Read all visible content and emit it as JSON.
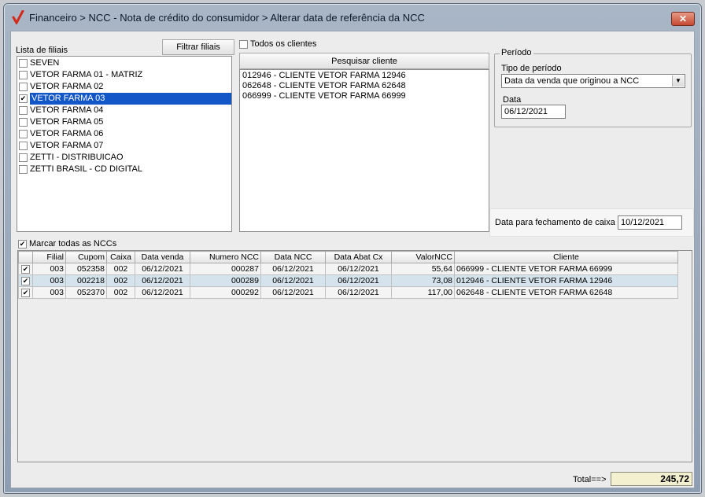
{
  "window": {
    "title": "Financeiro > NCC - Nota de crédito do consumidor > Alterar data de referência da NCC",
    "close_label": "✕"
  },
  "branches": {
    "label": "Lista de filiais",
    "filter_button": "Filtrar filiais",
    "items": [
      {
        "label": "SEVEN",
        "checked": false,
        "selected": false
      },
      {
        "label": "VETOR FARMA 01 - MATRIZ",
        "checked": false,
        "selected": false
      },
      {
        "label": "VETOR FARMA 02",
        "checked": false,
        "selected": false
      },
      {
        "label": "VETOR FARMA 03",
        "checked": true,
        "selected": true
      },
      {
        "label": "VETOR FARMA 04",
        "checked": false,
        "selected": false
      },
      {
        "label": "VETOR FARMA 05",
        "checked": false,
        "selected": false
      },
      {
        "label": "VETOR FARMA 06",
        "checked": false,
        "selected": false
      },
      {
        "label": "VETOR FARMA 07",
        "checked": false,
        "selected": false
      },
      {
        "label": "ZETTI - DISTRIBUICAO",
        "checked": false,
        "selected": false
      },
      {
        "label": "ZETTI BRASIL - CD DIGITAL",
        "checked": false,
        "selected": false
      }
    ]
  },
  "clients": {
    "all_label": "Todos os clientes",
    "all_checked": false,
    "search_button": "Pesquisar cliente",
    "items": [
      "012946 - CLIENTE VETOR FARMA 12946",
      "062648 - CLIENTE VETOR FARMA 62648",
      "066999 - CLIENTE VETOR FARMA 66999"
    ]
  },
  "period": {
    "group_title": "Período",
    "type_label": "Tipo de período",
    "type_value": "Data da venda que originou a NCC",
    "date_label": "Data",
    "date_value": "06/12/2021"
  },
  "closing": {
    "label": "Data para fechamento de caixa",
    "value": "10/12/2021"
  },
  "ncc": {
    "mark_all_label": "Marcar todas as NCCs",
    "mark_all_checked": true,
    "columns": [
      "Filial",
      "Cupom",
      "Caixa",
      "Data venda",
      "Numero NCC",
      "Data NCC",
      "Data Abat Cx",
      "ValorNCC",
      "Cliente"
    ],
    "rows": [
      {
        "checked": true,
        "cells": [
          "003",
          "052358",
          "002",
          "06/12/2021",
          "000287",
          "06/12/2021",
          "06/12/2021",
          "55,64",
          "066999 - CLIENTE VETOR FARMA 66999"
        ]
      },
      {
        "checked": true,
        "cells": [
          "003",
          "002218",
          "002",
          "06/12/2021",
          "000289",
          "06/12/2021",
          "06/12/2021",
          "73,08",
          "012946 - CLIENTE VETOR FARMA 12946"
        ]
      },
      {
        "checked": true,
        "cells": [
          "003",
          "052370",
          "002",
          "06/12/2021",
          "000292",
          "06/12/2021",
          "06/12/2021",
          "117,00",
          "062648 - CLIENTE VETOR FARMA 62648"
        ]
      }
    ]
  },
  "footer": {
    "total_label": "Total==>",
    "total_value": "245,72"
  },
  "colors": {
    "selection": "#1256c8",
    "alt_row": "#d5e3ec",
    "total_bg": "#f2f0cf",
    "logo_check": "#d42a1a"
  },
  "icons": {
    "app": "red-checkmark-icon",
    "close": "close-icon",
    "dropdown": "chevron-down-icon"
  }
}
